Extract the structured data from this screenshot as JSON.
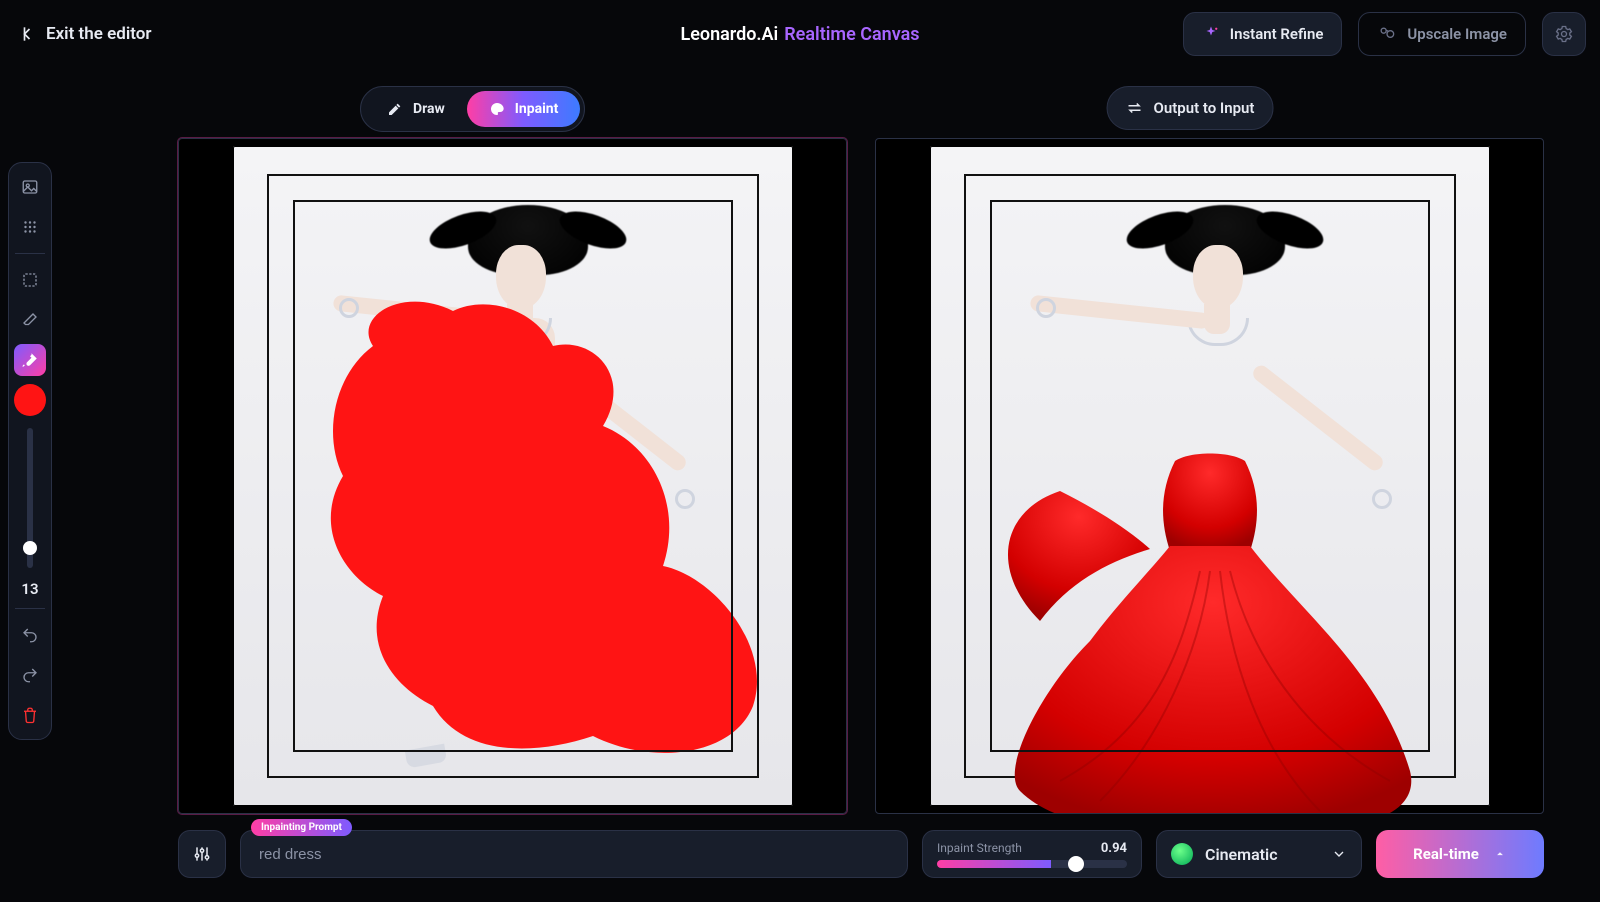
{
  "header": {
    "exit_label": "Exit the editor",
    "brand_a": "Leonardo.Ai ",
    "brand_b": "Realtime Canvas",
    "refine_label": "Instant Refine",
    "upscale_label": "Upscale Image"
  },
  "sidebar": {
    "brush_size": "13",
    "brush_color": "#ff1414",
    "tools": [
      "image",
      "elements",
      "select",
      "erase",
      "inpaint-brush"
    ]
  },
  "modes": {
    "draw_label": "Draw",
    "inpaint_label": "Inpaint",
    "output_to_input": "Output to Input"
  },
  "prompt": {
    "badge": "Inpainting Prompt",
    "value": "red dress"
  },
  "inpaint_strength": {
    "label": "Inpaint Strength",
    "value": "0.94"
  },
  "style": {
    "selected": "Cinematic"
  },
  "realtime": {
    "label": "Real-time"
  }
}
